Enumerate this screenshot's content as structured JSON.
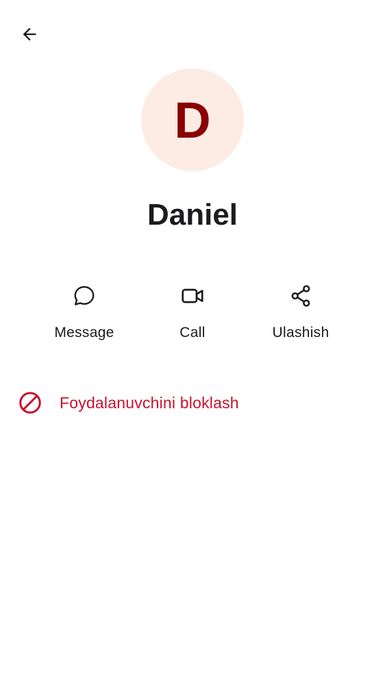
{
  "header": {
    "back_icon": "arrow-back-icon"
  },
  "contact": {
    "initial": "D",
    "name": "Daniel",
    "avatar_bg": "#fdece4",
    "avatar_fg": "#8b0000"
  },
  "actions": [
    {
      "label": "Message",
      "icon": "chat-bubble-icon"
    },
    {
      "label": "Call",
      "icon": "video-camera-icon"
    },
    {
      "label": "Ulashish",
      "icon": "share-icon"
    }
  ],
  "block": {
    "label": "Foydalanuvchini bloklash",
    "icon": "block-icon",
    "color": "#c8102e"
  },
  "colors": {
    "text_primary": "#1c1b1f",
    "background": "#ffffff"
  }
}
